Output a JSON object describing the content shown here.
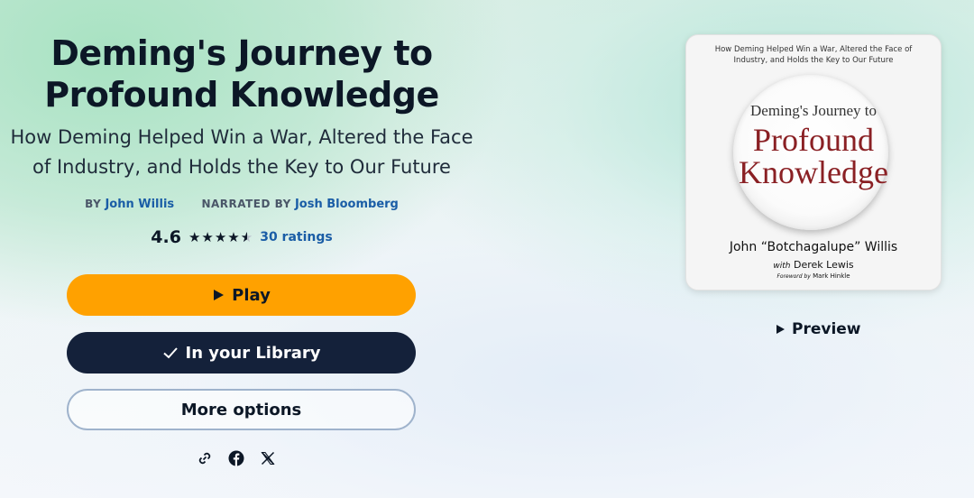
{
  "book": {
    "title": "Deming's Journey to Profound Knowledge",
    "subtitle": "How Deming Helped Win a War, Altered the Face of Industry, and Holds the Key to Our Future",
    "by_label": "BY",
    "author": "John Willis",
    "narrated_label": "NARRATED BY",
    "narrator": "Josh Bloomberg"
  },
  "rating": {
    "value": "4.6",
    "stars": 4.6,
    "count_label": "30 ratings"
  },
  "actions": {
    "play_label": "Play",
    "library_label": "In your Library",
    "more_label": "More options"
  },
  "share": {
    "icons": [
      "link-icon",
      "facebook-icon",
      "x-icon"
    ]
  },
  "cover": {
    "tagline": "How Deming Helped Win a War, Altered the Face of Industry, and Holds the Key to Our Future",
    "title_line1": "Deming's Journey to",
    "title_line2": "Profound",
    "title_line3": "Knowledge",
    "author": "John “Botchagalupe” Willis",
    "with_label": "with",
    "coauthor": "Derek Lewis",
    "foreword_label": "Foreword by",
    "foreword_author": "Mark Hinkle"
  },
  "preview": {
    "label": "Preview"
  },
  "colors": {
    "play_button": "#ffa100",
    "library_button": "#14213a",
    "link": "#1a5da6",
    "cover_title": "#8a2024"
  }
}
